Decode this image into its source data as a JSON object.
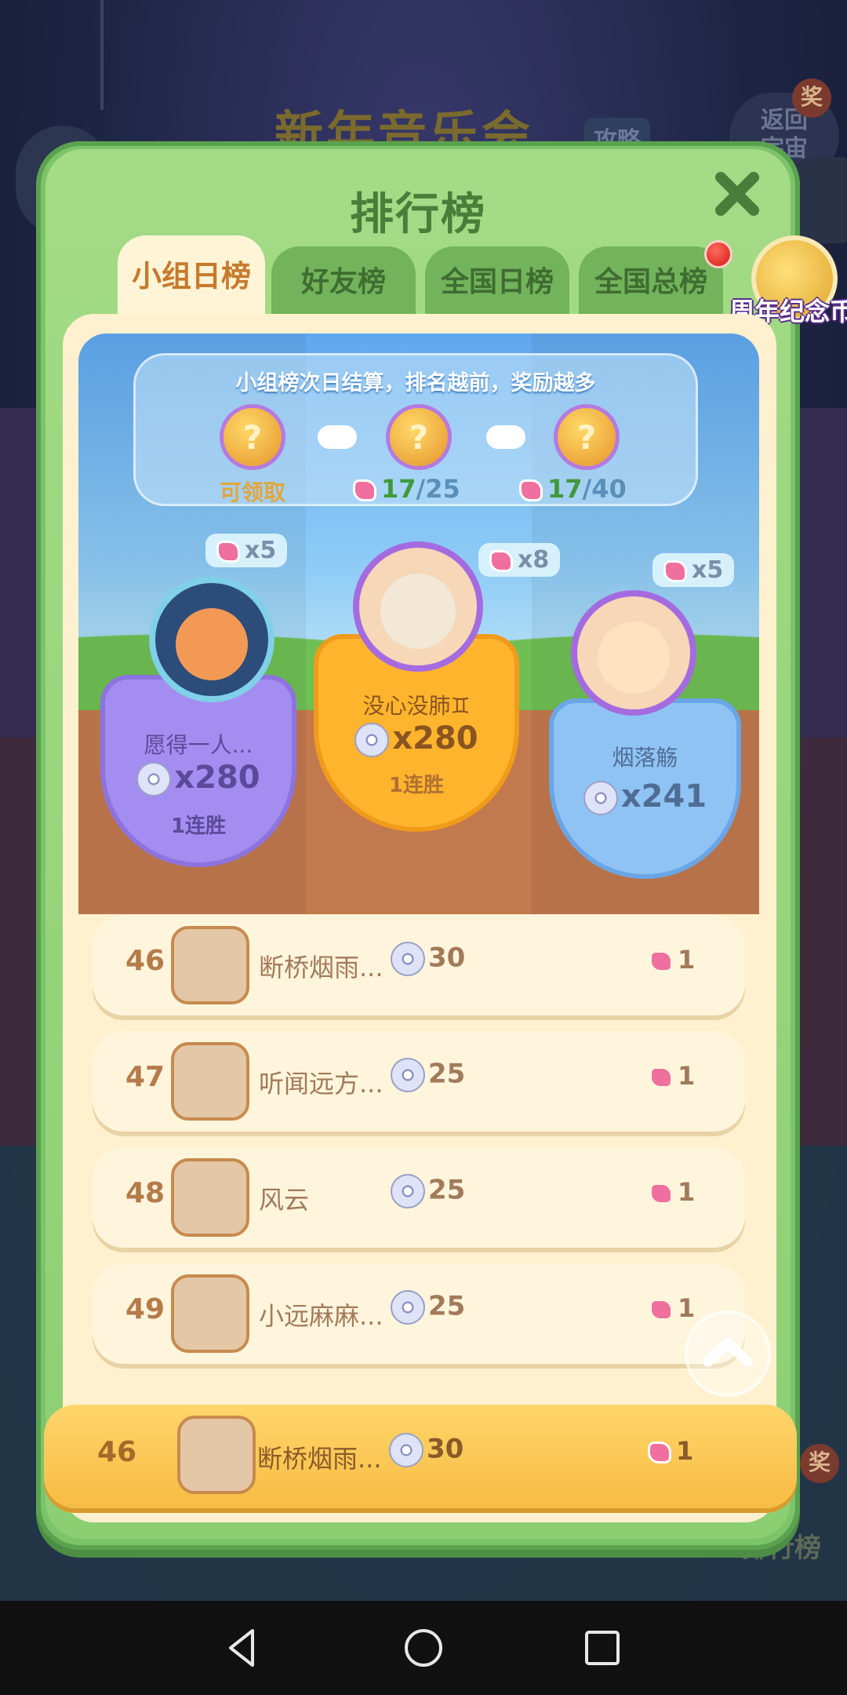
{
  "background": {
    "title": "新年音乐会",
    "strategy_label": "攻略",
    "return_label": "返回\n宇宙",
    "badge_label": "奖",
    "rank_label": "排行榜"
  },
  "modal": {
    "title": "排行榜",
    "tabs": [
      {
        "label": "小组日榜",
        "active": true
      },
      {
        "label": "好友榜",
        "active": false
      },
      {
        "label": "全国日榜",
        "active": false
      },
      {
        "label": "全国总榜",
        "active": false
      }
    ],
    "side_coin_label": "周年纪念币"
  },
  "rewards": {
    "info": "小组榜次日结算，排名越前，奖励越多",
    "items": [
      {
        "status": "可领取"
      },
      {
        "current": "17",
        "total": "/25"
      },
      {
        "current": "17",
        "total": "/40"
      }
    ],
    "coin_symbol": "?"
  },
  "podium": [
    {
      "place": 2,
      "bubble": "x5",
      "name": "愿得一人...",
      "score": "x280",
      "streak": "1连胜",
      "color": "#a48df0"
    },
    {
      "place": 1,
      "bubble": "x8",
      "name": "没心没肺♊",
      "score": "x280",
      "streak": "1连胜",
      "color": "#ffb42e"
    },
    {
      "place": 3,
      "bubble": "x5",
      "name": "烟落觞",
      "score": "x241",
      "streak": "",
      "color": "#8fc3f4"
    }
  ],
  "list": [
    {
      "rank": "46",
      "name": "断桥烟雨...",
      "score": "30",
      "flowers": "1"
    },
    {
      "rank": "47",
      "name": "听闻远方...",
      "score": "25",
      "flowers": "1"
    },
    {
      "rank": "48",
      "name": "风云",
      "score": "25",
      "flowers": "1"
    },
    {
      "rank": "49",
      "name": "小远麻麻...",
      "score": "25",
      "flowers": "1"
    }
  ],
  "self": {
    "rank": "46",
    "name": "断桥烟雨...",
    "score": "30",
    "flowers": "1"
  }
}
